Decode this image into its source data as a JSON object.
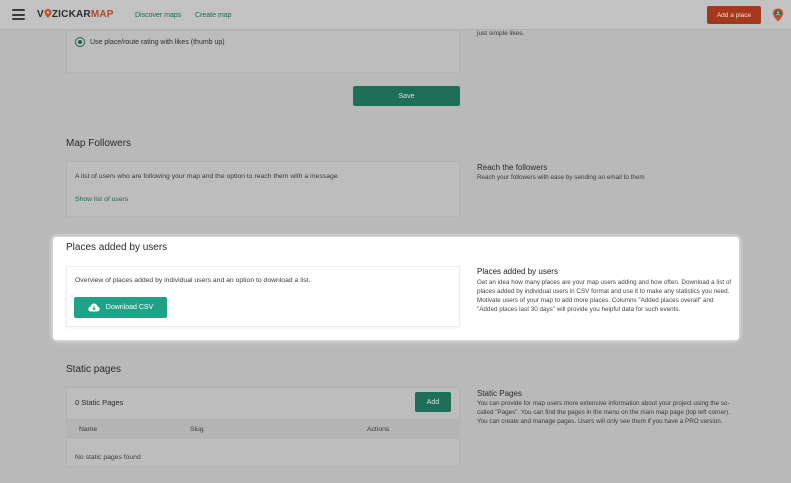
{
  "header": {
    "logo_parts": {
      "v": "V",
      "rest": "ZICKAR",
      "map": "MAP"
    },
    "nav": [
      {
        "label": "Discover maps"
      },
      {
        "label": "Create map"
      }
    ],
    "add_place_label": "Add a place",
    "icons": [
      "hamburger-icon",
      "map-pin-icon",
      "user-location-icon"
    ],
    "colors": {
      "brand": "#c8502c",
      "accent": "#1f8a70"
    }
  },
  "rating": {
    "option_label": "Use place/route rating with likes (thumb up)",
    "side_fragment": "just simple likes."
  },
  "save_label": "Save",
  "followers": {
    "title": "Map Followers",
    "description": "A list of users who are following your map and the option to reach them with a message.",
    "link_label": "Show list of users",
    "side_title": "Reach the followers",
    "side_description": "Reach your followers with ease by sending an email to them"
  },
  "places": {
    "title": "Places added by users",
    "description": "Overview of places added by individual users and an option to download a list.",
    "download_label": "Download CSV",
    "side_title": "Places added by users",
    "side_description": "Get an idea how many places are your map users adding and how often. Download a list of places added by individual users in CSV format and use it to make any statistics you need. Motivate users of your map to add more places. Columns \"Added places overall\" and \"Added places last 30 days\" will provide you helpful data for such events."
  },
  "static_pages": {
    "title": "Static pages",
    "count_label": "0 Static Pages",
    "add_label": "Add",
    "columns": [
      "Name",
      "Slug",
      "Actions"
    ],
    "empty_message": "No static pages found",
    "side_title": "Static Pages",
    "side_description": "You can provide for map users more extensive information about your project using the so-called \"Pages\". You can find the pages in the menu on the main map page (top left corner). You can create and manage pages. Users will only see them if you have a PRO version."
  }
}
